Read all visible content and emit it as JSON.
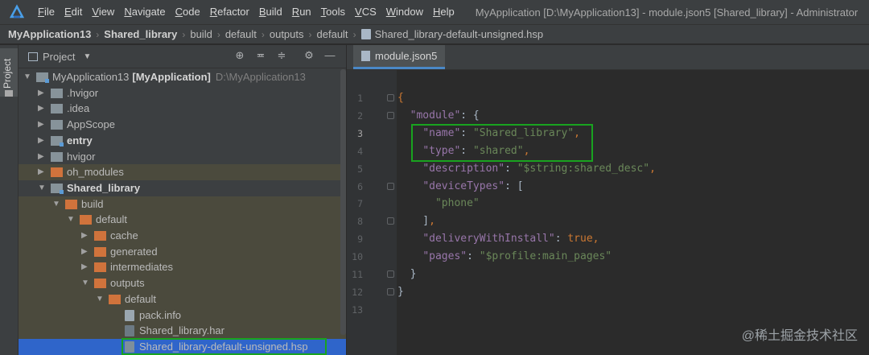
{
  "menubar": {
    "logo_icon": "deveco-logo-icon",
    "items": [
      "File",
      "Edit",
      "View",
      "Navigate",
      "Code",
      "Refactor",
      "Build",
      "Run",
      "Tools",
      "VCS",
      "Window",
      "Help"
    ],
    "window_title": "MyApplication [D:\\MyApplication13] - module.json5 [Shared_library] - Administrator"
  },
  "breadcrumb": {
    "items": [
      "MyApplication13",
      "Shared_library",
      "build",
      "default",
      "outputs",
      "default",
      "Shared_library-default-unsigned.hsp"
    ]
  },
  "toolwindow_strip": {
    "project_tab": "Project"
  },
  "project_panel": {
    "title": "Project",
    "tools": [
      "locate-icon",
      "collapse-icon",
      "expand-icon",
      "gear-icon",
      "minimize-icon"
    ],
    "tree": [
      {
        "label": "MyApplication13",
        "bold_suffix": "[MyApplication]",
        "path": "D:\\MyApplication13",
        "depth": 0,
        "state": "open",
        "icon": "module-folder-icon"
      },
      {
        "label": ".hvigor",
        "depth": 1,
        "state": "closed",
        "icon": "folder-icon"
      },
      {
        "label": ".idea",
        "depth": 1,
        "state": "closed",
        "icon": "folder-icon"
      },
      {
        "label": "AppScope",
        "depth": 1,
        "state": "closed",
        "icon": "folder-icon"
      },
      {
        "label": "entry",
        "depth": 1,
        "state": "closed",
        "icon": "module-folder-icon",
        "bold": true
      },
      {
        "label": "hvigor",
        "depth": 1,
        "state": "closed",
        "icon": "folder-icon"
      },
      {
        "label": "oh_modules",
        "depth": 1,
        "state": "closed",
        "icon": "excluded-folder-icon",
        "excluded": true
      },
      {
        "label": "Shared_library",
        "depth": 1,
        "state": "open",
        "icon": "module-folder-icon",
        "bold": true
      },
      {
        "label": "build",
        "depth": 2,
        "state": "open",
        "icon": "excluded-folder-icon",
        "excluded": true
      },
      {
        "label": "default",
        "depth": 3,
        "state": "open",
        "icon": "excluded-folder-icon",
        "excluded": true
      },
      {
        "label": "cache",
        "depth": 4,
        "state": "closed",
        "icon": "excluded-folder-icon",
        "excluded": true
      },
      {
        "label": "generated",
        "depth": 4,
        "state": "closed",
        "icon": "excluded-folder-icon",
        "excluded": true
      },
      {
        "label": "intermediates",
        "depth": 4,
        "state": "closed",
        "icon": "excluded-folder-icon",
        "excluded": true
      },
      {
        "label": "outputs",
        "depth": 4,
        "state": "open",
        "icon": "excluded-folder-icon",
        "excluded": true
      },
      {
        "label": "default",
        "depth": 5,
        "state": "open",
        "icon": "excluded-folder-icon",
        "excluded": true
      },
      {
        "label": "pack.info",
        "depth": 6,
        "state": "leaf",
        "icon": "file-icon",
        "excluded": true
      },
      {
        "label": "Shared_library.har",
        "depth": 6,
        "state": "leaf",
        "icon": "archive-icon",
        "excluded": true
      },
      {
        "label": "Shared_library-default-unsigned.hsp",
        "depth": 6,
        "state": "leaf",
        "icon": "archive-icon",
        "selected": true,
        "highlighted": true
      }
    ]
  },
  "editor": {
    "tab_label": "module.json5",
    "current_line": 3,
    "lines": [
      [
        [
          "p",
          "{"
        ]
      ],
      [
        [
          "t",
          "  "
        ],
        [
          "k",
          "\"module\""
        ],
        [
          "t",
          ": {"
        ]
      ],
      [
        [
          "t",
          "    "
        ],
        [
          "k",
          "\"name\""
        ],
        [
          "t",
          ": "
        ],
        [
          "s",
          "\"Shared_library\""
        ],
        [
          "p",
          ","
        ]
      ],
      [
        [
          "t",
          "    "
        ],
        [
          "k",
          "\"type\""
        ],
        [
          "t",
          ": "
        ],
        [
          "s",
          "\"shared\""
        ],
        [
          "p",
          ","
        ]
      ],
      [
        [
          "t",
          "    "
        ],
        [
          "k",
          "\"description\""
        ],
        [
          "t",
          ": "
        ],
        [
          "s",
          "\"$string:shared_desc\""
        ],
        [
          "p",
          ","
        ]
      ],
      [
        [
          "t",
          "    "
        ],
        [
          "k",
          "\"deviceTypes\""
        ],
        [
          "t",
          ": ["
        ]
      ],
      [
        [
          "t",
          "      "
        ],
        [
          "s",
          "\"phone\""
        ]
      ],
      [
        [
          "t",
          "    ]"
        ],
        [
          "p",
          ","
        ]
      ],
      [
        [
          "t",
          "    "
        ],
        [
          "k",
          "\"deliveryWithInstall\""
        ],
        [
          "t",
          ": "
        ],
        [
          "w",
          "true"
        ],
        [
          "p",
          ","
        ]
      ],
      [
        [
          "t",
          "    "
        ],
        [
          "k",
          "\"pages\""
        ],
        [
          "t",
          ": "
        ],
        [
          "s",
          "\"$profile:main_pages\""
        ]
      ],
      [
        [
          "t",
          "  }"
        ]
      ],
      [
        [
          "t",
          "}"
        ]
      ],
      []
    ],
    "highlighted_lines": [
      3,
      4
    ]
  },
  "watermark": "@稀土掘金技术社区",
  "colors": {
    "highlight_border": "#19a31f",
    "selection": "#2f65ca",
    "excluded_bg": "#4b4a3d",
    "json_key": "#9876aa",
    "json_string": "#6a8759",
    "json_keyword": "#cc7832"
  }
}
